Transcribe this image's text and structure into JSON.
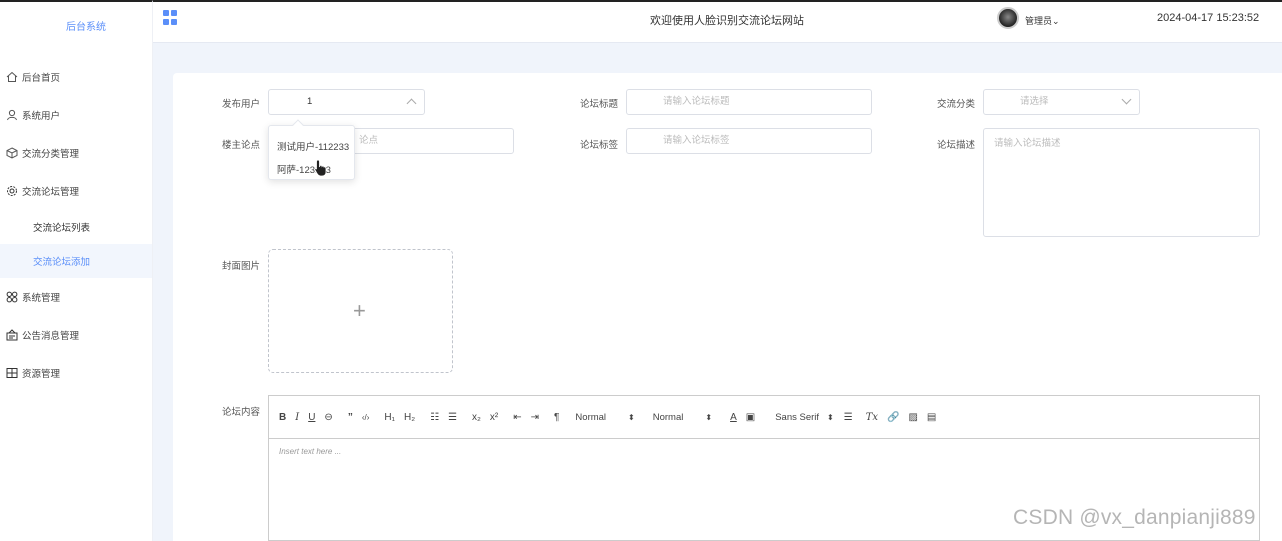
{
  "sidebar": {
    "brand": "后台系统",
    "items": [
      {
        "label": "后台首页",
        "icon": "home-icon"
      },
      {
        "label": "系统用户",
        "icon": "user-icon"
      },
      {
        "label": "交流分类管理",
        "icon": "cube-icon"
      },
      {
        "label": "交流论坛管理",
        "icon": "gear-icon"
      },
      {
        "label": "系统管理",
        "icon": "apps-icon"
      },
      {
        "label": "公告消息管理",
        "icon": "notice-icon"
      },
      {
        "label": "资源管理",
        "icon": "grid-icon"
      }
    ],
    "subitems": [
      {
        "label": "交流论坛列表"
      },
      {
        "label": "交流论坛添加"
      }
    ]
  },
  "header": {
    "title": "欢迎使用人脸识别交流论坛网站",
    "user": "管理员",
    "datetime": "2024-04-17 15:23:52"
  },
  "form": {
    "publisher": {
      "label": "发布用户",
      "value": "1"
    },
    "forum_title": {
      "label": "论坛标题",
      "placeholder": "请输入论坛标题"
    },
    "category": {
      "label": "交流分类",
      "placeholder": "请选择"
    },
    "thread_point": {
      "label": "楼主论点",
      "placeholder": "论点"
    },
    "forum_tag": {
      "label": "论坛标签",
      "placeholder": "请输入论坛标签"
    },
    "forum_desc": {
      "label": "论坛描述",
      "placeholder": "请输入论坛描述"
    },
    "cover": {
      "label": "封面图片"
    },
    "content": {
      "label": "论坛内容",
      "placeholder": "Insert text here ..."
    }
  },
  "dropdown": {
    "options": [
      "测试用户-112233",
      "阿萨-123123"
    ]
  },
  "editor_toolbar": {
    "h1": "H₁",
    "h2": "H₂",
    "sub": "x₂",
    "sup": "x²",
    "size_picker": "Normal",
    "header_picker": "Normal",
    "font_picker": "Sans Serif"
  },
  "watermark": "CSDN @vx_danpianji889",
  "colors": {
    "accent": "#5b8ff9",
    "background": "#f0f4fb"
  }
}
